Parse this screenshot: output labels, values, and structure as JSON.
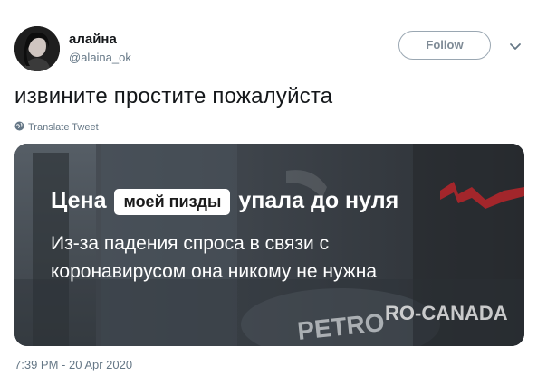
{
  "author": {
    "display_name": "алайна",
    "handle": "@alaina_ok"
  },
  "actions": {
    "follow_label": "Follow",
    "menu_icon": "chevron-down-icon"
  },
  "tweet": {
    "text": "извините простите пожалуйста",
    "translate_label": "Translate Tweet",
    "timestamp": "7:39 PM - 20 Apr 2020"
  },
  "media": {
    "headline_before": "Цена",
    "headline_highlight": "моей пизды",
    "headline_after": "упала до нуля",
    "subline": "Из-за падения спроса в связи с коронавирусом она никому не нужна",
    "brand_text_1": "PETRO",
    "brand_text_2": "RO-CANADA"
  },
  "colors": {
    "text_primary": "#14171a",
    "text_secondary": "#657786",
    "follow_border": "#9aa7b2",
    "media_overlay": "#3b4148",
    "brand_red": "#d0282c"
  }
}
